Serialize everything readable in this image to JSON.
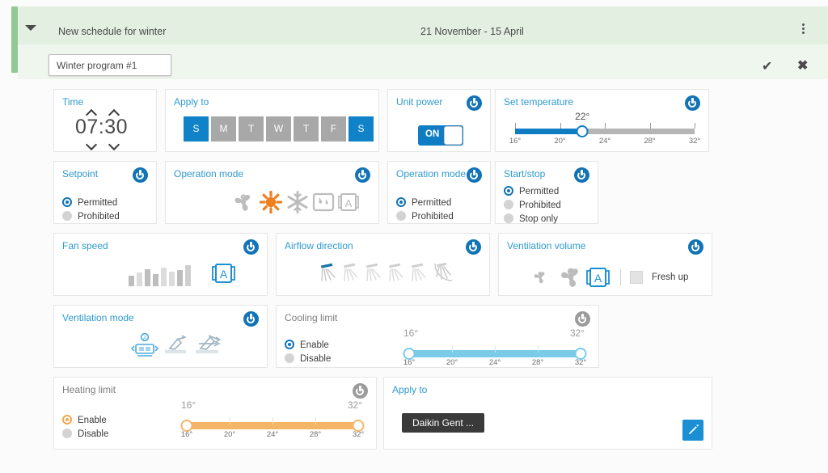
{
  "header": {
    "title": "New schedule for winter",
    "date_range": "21 November - 15 April",
    "program_name": "Winter program #1",
    "menu_icon": "kebab-menu-icon",
    "confirm_label": "✔",
    "cancel_label": "✖",
    "expand_icon": "caret-down-icon"
  },
  "cards": {
    "time": {
      "title": "Time",
      "value": "07:30"
    },
    "apply_to_days": {
      "title": "Apply to",
      "days": [
        {
          "label": "S",
          "selected": true
        },
        {
          "label": "M",
          "selected": false
        },
        {
          "label": "T",
          "selected": false
        },
        {
          "label": "W",
          "selected": false
        },
        {
          "label": "T",
          "selected": false
        },
        {
          "label": "F",
          "selected": false
        },
        {
          "label": "S",
          "selected": true
        }
      ]
    },
    "unit_power": {
      "title": "Unit power",
      "toggle_label": "ON",
      "state": "on"
    },
    "set_temperature": {
      "title": "Set temperature",
      "value_label": "22°",
      "value": 22,
      "min": 16,
      "max": 32,
      "ticks": [
        "16°",
        "20°",
        "24°",
        "28°",
        "32°"
      ]
    },
    "setpoint": {
      "title": "Setpoint",
      "options": [
        {
          "label": "Permitted",
          "selected": true
        },
        {
          "label": "Prohibited",
          "selected": false
        }
      ]
    },
    "operation_mode_icons": {
      "title": "Operation mode",
      "icons": [
        {
          "name": "fan-icon",
          "selected": false
        },
        {
          "name": "heat-sun-icon",
          "selected": true
        },
        {
          "name": "cool-snowflake-icon",
          "selected": false
        },
        {
          "name": "dry-humidity-icon",
          "selected": false
        },
        {
          "name": "auto-mode-icon",
          "selected": false
        }
      ]
    },
    "operation_mode_perm": {
      "title": "Operation mode",
      "options": [
        {
          "label": "Permitted",
          "selected": true
        },
        {
          "label": "Prohibited",
          "selected": false
        }
      ]
    },
    "start_stop": {
      "title": "Start/stop",
      "options": [
        {
          "label": "Permitted",
          "selected": true
        },
        {
          "label": "Prohibited",
          "selected": false
        },
        {
          "label": "Stop only",
          "selected": false
        }
      ]
    },
    "fan_speed": {
      "title": "Fan speed",
      "levels": [
        1,
        2,
        3,
        4,
        5,
        6,
        7,
        8
      ],
      "auto_label": "A",
      "auto_selected": true
    },
    "airflow_direction": {
      "title": "Airflow direction",
      "positions": [
        "p0",
        "p1",
        "p2",
        "p3",
        "p4",
        "swing"
      ],
      "selected_index": 0
    },
    "ventilation_volume": {
      "title": "Ventilation volume",
      "icons": [
        {
          "name": "fan-low-icon",
          "selected": false
        },
        {
          "name": "fan-high-icon",
          "selected": false
        },
        {
          "name": "auto-mode-icon",
          "selected": true
        }
      ],
      "fresh_up_label": "Fresh up",
      "fresh_up_checked": false
    },
    "ventilation_mode": {
      "title": "Ventilation mode",
      "icons": [
        {
          "name": "ventilation-auto-icon",
          "selected": true
        },
        {
          "name": "ventilation-heat-exchange-icon",
          "selected": false
        },
        {
          "name": "ventilation-bypass-icon",
          "selected": false
        }
      ]
    },
    "cooling_limit": {
      "title": "Cooling limit",
      "power_state": "off",
      "options": [
        {
          "label": "Enable",
          "selected": true
        },
        {
          "label": "Disable",
          "selected": false
        }
      ],
      "low_label": "16°",
      "high_label": "32°",
      "low": 16,
      "high": 32,
      "min": 16,
      "max": 32,
      "ticks": [
        "16°",
        "20°",
        "24°",
        "28°",
        "32°"
      ]
    },
    "heating_limit": {
      "title": "Heating limit",
      "power_state": "off",
      "options": [
        {
          "label": "Enable",
          "selected": true
        },
        {
          "label": "Disable",
          "selected": false
        }
      ],
      "low_label": "16°",
      "high_label": "32°",
      "low": 16,
      "high": 32,
      "min": 16,
      "max": 32,
      "ticks": [
        "16°",
        "20°",
        "24°",
        "28°",
        "32°"
      ]
    },
    "apply_to_zone": {
      "title": "Apply to",
      "tag": "Daikin Gent ...",
      "edit_icon": "pencil-icon"
    }
  },
  "colors": {
    "accent_blue": "#0f7cc4",
    "title_blue": "#2e9ad0",
    "header_green": "#e2efe1",
    "rail_green": "#92c894",
    "orange": "#f5b567",
    "cyan": "#79cbe8",
    "gray_pill": "#a8a8a8"
  }
}
